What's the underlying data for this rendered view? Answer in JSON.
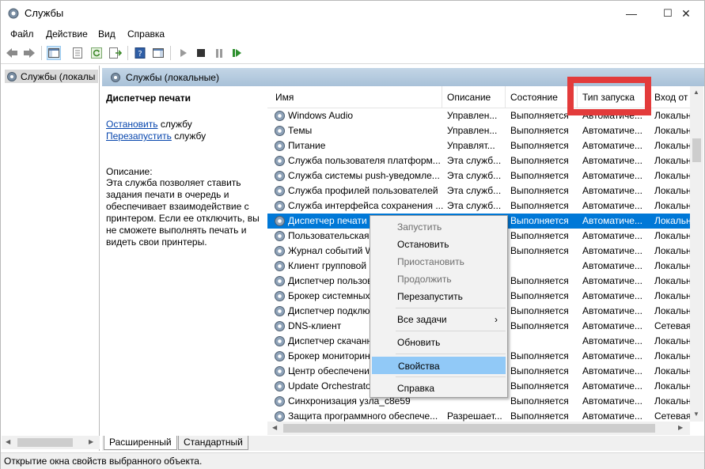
{
  "window": {
    "title": "Службы",
    "minimize": "—",
    "maximize": "☐",
    "close": "✕"
  },
  "menu": [
    "Файл",
    "Действие",
    "Вид",
    "Справка"
  ],
  "tree": {
    "item": "Службы (локалы"
  },
  "header": {
    "title": "Службы (локальные)"
  },
  "details": {
    "service_name": "Диспетчер печати",
    "stop_link": "Остановить",
    "stop_suffix": " службу",
    "restart_link": "Перезапустить",
    "restart_suffix": " службу",
    "desc_label": "Описание:",
    "desc_text": "Эта служба позволяет ставить задания печати в очередь и обеспечивает взаимодействие с принтером. Если ее отключить, вы не сможете выполнять печать и видеть свои принтеры."
  },
  "columns": [
    "Имя",
    "Описание",
    "Состояние",
    "Тип запуска",
    "Вход от и"
  ],
  "rows": [
    [
      "Windows Audio",
      "Управлен...",
      "Выполняется",
      "Автоматиче...",
      "Локальн"
    ],
    [
      "Темы",
      "Управлен...",
      "Выполняется",
      "Автоматиче...",
      "Локальн"
    ],
    [
      "Питание",
      "Управлят...",
      "Выполняется",
      "Автоматиче...",
      "Локальн"
    ],
    [
      "Служба пользователя платформ...",
      "Эта служб...",
      "Выполняется",
      "Автоматиче...",
      "Локальн"
    ],
    [
      "Служба системы push-уведомле...",
      "Эта служб...",
      "Выполняется",
      "Автоматиче...",
      "Локальн"
    ],
    [
      "Служба профилей пользователей",
      "Эта служб...",
      "Выполняется",
      "Автоматиче...",
      "Локальн"
    ],
    [
      "Служба интерфейса сохранения ...",
      "Эта служб...",
      "Выполняется",
      "Автоматиче...",
      "Локальн"
    ],
    [
      "Диспетчер печати",
      "",
      "Выполняется",
      "Автоматиче...",
      "Локальн"
    ],
    [
      "Пользовательская",
      "",
      "Выполняется",
      "Автоматиче...",
      "Локальн"
    ],
    [
      "Журнал событий W",
      "",
      "Выполняется",
      "Автоматиче...",
      "Локальн"
    ],
    [
      "Клиент групповой",
      "",
      "",
      "Автоматиче...",
      "Локальн"
    ],
    [
      "Диспетчер пользов",
      "",
      "Выполняется",
      "Автоматиче...",
      "Локальн"
    ],
    [
      "Брокер системных",
      "",
      "Выполняется",
      "Автоматиче...",
      "Локальн"
    ],
    [
      "Диспетчер подклю",
      "",
      "Выполняется",
      "Автоматиче...",
      "Локальн"
    ],
    [
      "DNS-клиент",
      "",
      "Выполняется",
      "Автоматиче...",
      "Сетевая"
    ],
    [
      "Диспетчер скачанн",
      "",
      "",
      "Автоматиче...",
      "Локальн"
    ],
    [
      "Брокер мониторинг",
      "",
      "Выполняется",
      "Автоматиче...",
      "Локальн"
    ],
    [
      "Центр обеспечени",
      "",
      "Выполняется",
      "Автоматиче...",
      "Локальн"
    ],
    [
      "Update Orchestrato",
      "",
      "Выполняется",
      "Автоматиче...",
      "Локальн"
    ],
    [
      "Синхронизация узла_c8e59",
      "",
      "Выполняется",
      "Автоматиче...",
      "Локальн"
    ],
    [
      "Защита программного обеспече...",
      "Разрешает...",
      "Выполняется",
      "Автоматиче...",
      "Сетевая"
    ]
  ],
  "context_menu": {
    "start": "Запустить",
    "stop": "Остановить",
    "pause": "Приостановить",
    "resume": "Продолжить",
    "restart": "Перезапустить",
    "all_tasks": "Все задачи",
    "refresh": "Обновить",
    "properties": "Свойства",
    "help": "Справка"
  },
  "tabs": [
    "Расширенный",
    "Стандартный"
  ],
  "status": "Открытие окна свойств выбранного объекта.",
  "colors": {
    "selection": "#0078d7",
    "highlight_box": "#e33b3b",
    "menu_hover": "#91c9f7"
  }
}
